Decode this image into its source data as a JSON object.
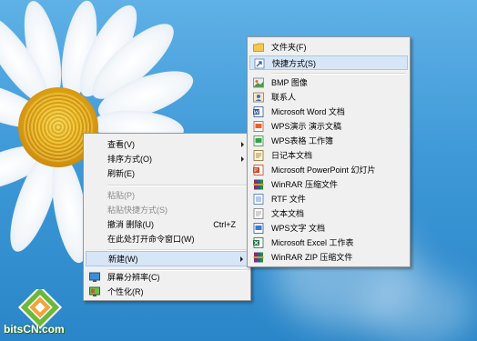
{
  "context_menu": {
    "items": [
      {
        "label": "查看(V)",
        "submenu": true
      },
      {
        "label": "排序方式(O)",
        "submenu": true
      },
      {
        "label": "刷新(E)"
      },
      {
        "label": "粘贴(P)",
        "disabled": true
      },
      {
        "label": "粘贴快捷方式(S)",
        "disabled": true
      },
      {
        "label": "撤消 删除(U)",
        "shortcut": "Ctrl+Z"
      },
      {
        "label": "在此处打开命令窗口(W)"
      },
      {
        "label": "新建(W)",
        "submenu": true,
        "highlighted": true
      },
      {
        "label": "屏幕分辨率(C)",
        "icon": "display-icon"
      },
      {
        "label": "个性化(R)",
        "icon": "personalize-icon"
      }
    ]
  },
  "new_submenu": {
    "items": [
      {
        "label": "文件夹(F)",
        "icon": "folder-icon"
      },
      {
        "label": "快捷方式(S)",
        "icon": "shortcut-icon",
        "highlighted": true
      },
      {
        "label": "BMP 图像",
        "icon": "bmp-image-icon"
      },
      {
        "label": "联系人",
        "icon": "contact-icon"
      },
      {
        "label": "Microsoft Word 文档",
        "icon": "word-document-icon"
      },
      {
        "label": "WPS演示 演示文稿",
        "icon": "wps-presentation-icon"
      },
      {
        "label": "WPS表格 工作簿",
        "icon": "wps-spreadsheet-icon"
      },
      {
        "label": "日记本文档",
        "icon": "journal-document-icon"
      },
      {
        "label": "Microsoft PowerPoint 幻灯片",
        "icon": "powerpoint-icon"
      },
      {
        "label": "WinRAR 压缩文件",
        "icon": "winrar-icon"
      },
      {
        "label": "RTF 文件",
        "icon": "rtf-file-icon"
      },
      {
        "label": "文本文档",
        "icon": "text-document-icon"
      },
      {
        "label": "WPS文字 文档",
        "icon": "wps-writer-icon"
      },
      {
        "label": "Microsoft Excel 工作表",
        "icon": "excel-icon"
      },
      {
        "label": "WinRAR ZIP 压缩文件",
        "icon": "winrar-zip-icon"
      }
    ]
  },
  "watermark": {
    "text": "bitsCN.com"
  },
  "colors": {
    "highlight": "#d6e6f7",
    "menu_bg": "#f0f0f0",
    "sky": "#3f99d8"
  }
}
